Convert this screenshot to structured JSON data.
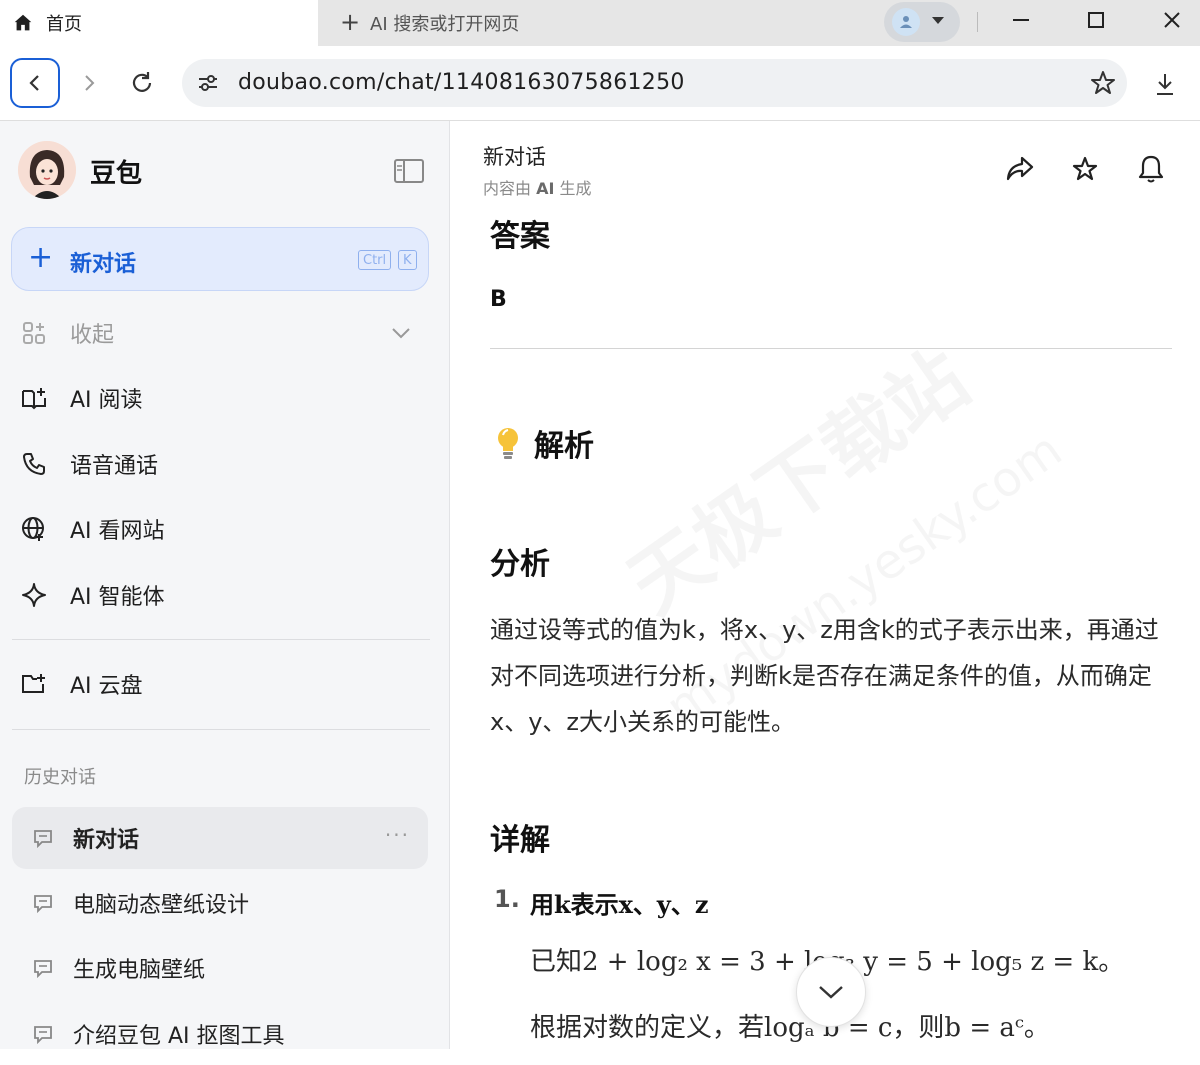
{
  "browser": {
    "active_tab_title": "首页",
    "new_tab_label": "AI 搜索或打开网页",
    "url": "doubao.com/chat/11408163075861250"
  },
  "sidebar": {
    "app_name": "豆包",
    "new_chat": {
      "label": "新对话",
      "shortcut_ctrl": "Ctrl",
      "shortcut_key": "K"
    },
    "collapse_label": "收起",
    "items": [
      {
        "label": "AI 阅读",
        "icon": "book-icon"
      },
      {
        "label": "语音通话",
        "icon": "phone-icon"
      },
      {
        "label": "AI 看网站",
        "icon": "globe-icon"
      },
      {
        "label": "AI 智能体",
        "icon": "sparkle-icon"
      }
    ],
    "cloud": {
      "label": "AI 云盘",
      "icon": "cloud-folder-icon"
    },
    "history_title": "历史对话",
    "history": [
      {
        "label": "新对话",
        "active": true,
        "more": "···"
      },
      {
        "label": "电脑动态壁纸设计",
        "active": false
      },
      {
        "label": "生成电脑壁纸",
        "active": false
      },
      {
        "label": "介绍豆包 AI 抠图工具",
        "active": false
      }
    ]
  },
  "main": {
    "title": "新对话",
    "subtitle_prefix": "内容由 ",
    "subtitle_ai": "AI",
    "subtitle_suffix": " 生成",
    "answer_heading": "答案",
    "answer_value": "B",
    "analysis_heading": "解析",
    "analysis_sub_heading": "分析",
    "analysis_text": "通过设等式的值为k，将x、y、z用含k的式子表示出来，再通过对不同选项进行分析，判断k是否存在满足条件的值，从而确定x、y、z大小关系的可能性。",
    "detail_heading": "详解",
    "step_number": "1.",
    "step_head": "用k表示x、y、z",
    "math_line_1": "已知2 + log₂ x = 3 + log₃ y = 5 + log₅ z = k。",
    "math_line_2": "根据对数的定义，若logₐ b = c，则b = aᶜ。"
  },
  "watermark": {
    "text": "天极下载站",
    "url": "mydown.yesky.com"
  },
  "colors": {
    "accent": "#1a5fd6",
    "sidebar_bg": "#f5f6f8",
    "new_chat_bg": "#e3ebfd"
  }
}
